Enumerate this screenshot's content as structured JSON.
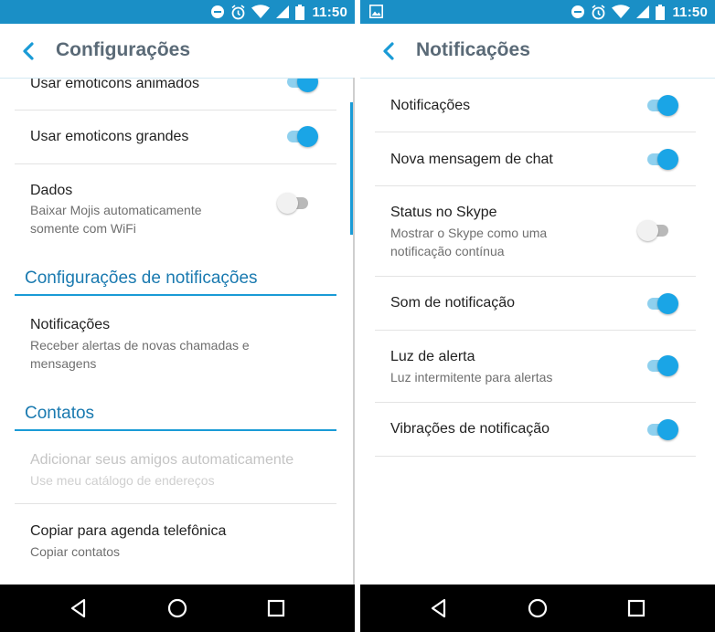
{
  "status_bar": {
    "time": "11:50",
    "icons": [
      "do-not-disturb-icon",
      "alarm-icon",
      "wifi-icon",
      "signal-icon",
      "battery-icon"
    ],
    "right_screen_extra_icon": "image-notification-icon",
    "color": "#1a8fc6"
  },
  "left_screen": {
    "title": "Configurações",
    "rows_top": [
      {
        "title": "Usar emoticons animados",
        "toggle": true
      },
      {
        "title": "Usar emoticons grandes",
        "toggle": true
      },
      {
        "title": "Dados",
        "subtitle": "Baixar Mojis automaticamente somente com WiFi",
        "toggle": false
      }
    ],
    "section_notifications": "Configurações de notificações",
    "notifications_row": {
      "title": "Notificações",
      "subtitle": "Receber alertas de novas chamadas e mensagens"
    },
    "section_contacts": "Contatos",
    "contacts_rows": [
      {
        "title": "Adicionar seus amigos automaticamente",
        "subtitle": "Use meu catálogo de endereços",
        "disabled": true
      },
      {
        "title": "Copiar para agenda telefônica",
        "subtitle": "Copiar contatos",
        "disabled": false
      }
    ]
  },
  "right_screen": {
    "title": "Notificações",
    "rows": [
      {
        "title": "Notificações",
        "toggle": true
      },
      {
        "title": "Nova mensagem de chat",
        "toggle": true
      },
      {
        "title": "Status no Skype",
        "subtitle": "Mostrar o Skype como uma notificação contínua",
        "toggle": false
      },
      {
        "title": "Som de notificação",
        "toggle": true
      },
      {
        "title": "Luz de alerta",
        "subtitle": "Luz intermitente para alertas",
        "toggle": true
      },
      {
        "title": "Vibrações de notificação",
        "toggle": true
      }
    ]
  },
  "nav_bar": {
    "buttons": [
      "back-icon",
      "home-icon",
      "recents-icon"
    ]
  },
  "colors": {
    "accent": "#1aa5e6",
    "section_text": "#1a7ab0",
    "title_text": "#5a6a77"
  }
}
